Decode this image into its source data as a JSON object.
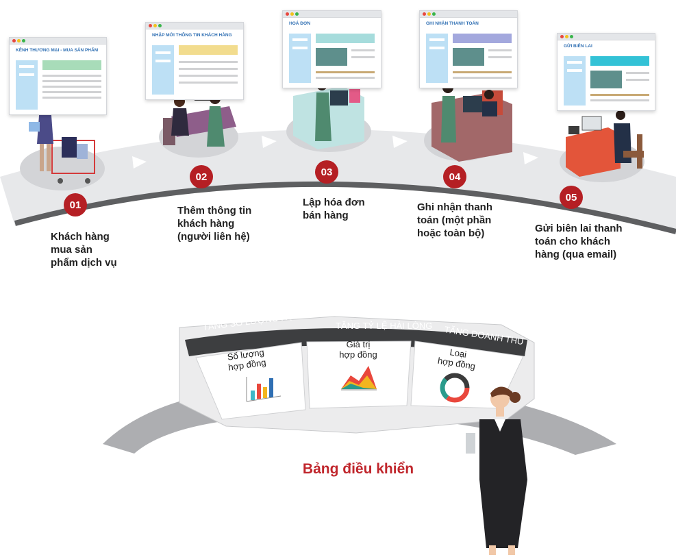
{
  "process": {
    "steps": [
      {
        "number": "01",
        "text": "Khách hàng\nmua sản\nphẩm dịch vụ",
        "window_title": "KÊNH THƯƠNG MẠI - MUA SẢN PHẨM"
      },
      {
        "number": "02",
        "text": "Thêm thông tin\nkhách hàng\n(người liên hệ)",
        "window_title": "NHẬP MỚI THÔNG TIN KHÁCH HÀNG"
      },
      {
        "number": "03",
        "text": "Lập hóa đơn\nbán hàng",
        "window_title": "HOÁ ĐƠN"
      },
      {
        "number": "04",
        "text": "Ghi nhận thanh\ntoán (một phần\nhoặc toàn bộ)",
        "window_title": "GHI NHẬN THANH TOÁN"
      },
      {
        "number": "05",
        "text": "Gửi biên lai thanh\ntoán cho khách\nhàng (qua email)",
        "window_title": "GỬI BIÊN LAI"
      }
    ]
  },
  "dashboard": {
    "title": "Bảng điều khiển",
    "panels": [
      {
        "header": "TĂNG SỐ LƯỢNG HỢP ĐỒNG",
        "label": "Số lượng\nhợp đồng",
        "chart_icon": "bar-chart-icon"
      },
      {
        "header": "TĂNG TỶ LỆ HÀI LÒNG",
        "label": "Giá trị\nhợp đồng",
        "chart_icon": "area-chart-icon"
      },
      {
        "header": "TĂNG DOANH THU",
        "label": "Loại\nhợp đồng",
        "chart_icon": "donut-chart-icon"
      }
    ]
  },
  "colors": {
    "accent_red": "#b51f24",
    "title_red": "#c0262c",
    "window_title_blue": "#2f6fb3",
    "road_grey": "#e6e7e9",
    "road_edge": "#5f6062",
    "panel_header": "#3d3e40"
  }
}
